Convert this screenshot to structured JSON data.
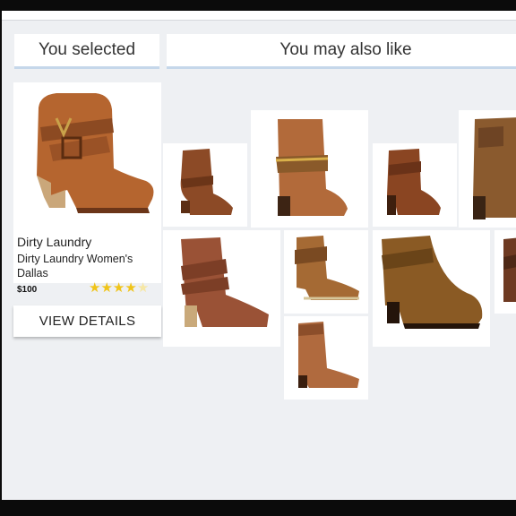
{
  "tabs": {
    "selected": "You selected",
    "also_like": "You may also like"
  },
  "selected_product": {
    "brand": "Dirty Laundry",
    "name": "Dirty Laundry Women's Dallas",
    "price": "$100",
    "rating": 4,
    "rating_max": 5
  },
  "buttons": {
    "view_details": "VIEW DETAILS"
  },
  "recommendations": [
    {
      "item": "boot-1"
    },
    {
      "item": "boot-2"
    },
    {
      "item": "boot-3"
    },
    {
      "item": "boot-4"
    },
    {
      "item": "boot-5"
    },
    {
      "item": "boot-6"
    },
    {
      "item": "boot-7"
    },
    {
      "item": "boot-8"
    },
    {
      "item": "boot-9"
    }
  ],
  "colors": {
    "page": "#eef0f3",
    "tab_underline": "#c5d7ea",
    "star": "#f0c419",
    "leather_main": "#b5652f",
    "leather_dark": "#7a3e1c"
  }
}
